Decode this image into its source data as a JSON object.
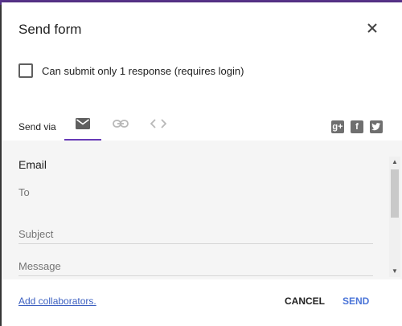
{
  "dialog": {
    "title": "Send form"
  },
  "options": {
    "single_response_label": "Can submit only 1 response (requires login)",
    "single_response_checked": false
  },
  "send_via": {
    "label": "Send via",
    "tabs": [
      {
        "name": "email",
        "icon": "envelope-icon",
        "active": true
      },
      {
        "name": "link",
        "icon": "link-icon",
        "active": false
      },
      {
        "name": "embed",
        "icon": "code-icon",
        "active": false
      }
    ],
    "social": [
      {
        "name": "google-plus",
        "glyph": "g+"
      },
      {
        "name": "facebook",
        "glyph": "f"
      },
      {
        "name": "twitter",
        "glyph": "t"
      }
    ]
  },
  "email": {
    "section_title": "Email",
    "to_placeholder": "To",
    "subject_placeholder": "Subject",
    "message_placeholder": "Message"
  },
  "footer": {
    "add_collaborators": "Add collaborators.",
    "cancel": "CANCEL",
    "send": "SEND"
  },
  "colors": {
    "accent": "#673ab7",
    "send": "#4a74d8",
    "link": "#3b5fc0"
  }
}
